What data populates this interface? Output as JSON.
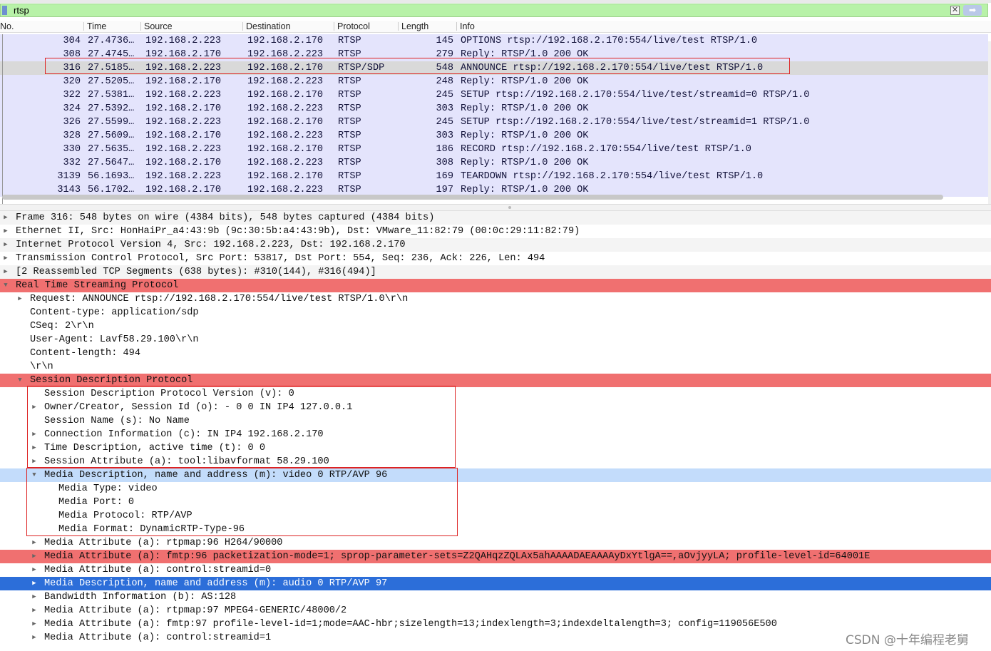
{
  "filter": {
    "value": "rtsp",
    "clear_icon": "clear-icon",
    "apply_icon": "apply-arrow-icon"
  },
  "columns": [
    "No.",
    "Time",
    "Source",
    "Destination",
    "Protocol",
    "Length",
    "Info"
  ],
  "packets": [
    {
      "no": "304",
      "time": "27.4736…",
      "src": "192.168.2.223",
      "dst": "192.168.2.170",
      "proto": "RTSP",
      "len": "145",
      "info": "OPTIONS rtsp://192.168.2.170:554/live/test RTSP/1.0"
    },
    {
      "no": "308",
      "time": "27.4745…",
      "src": "192.168.2.170",
      "dst": "192.168.2.223",
      "proto": "RTSP",
      "len": "279",
      "info": "Reply: RTSP/1.0 200 OK"
    },
    {
      "no": "316",
      "time": "27.5185…",
      "src": "192.168.2.223",
      "dst": "192.168.2.170",
      "proto": "RTSP/SDP",
      "len": "548",
      "info": "ANNOUNCE rtsp://192.168.2.170:554/live/test RTSP/1.0"
    },
    {
      "no": "320",
      "time": "27.5205…",
      "src": "192.168.2.170",
      "dst": "192.168.2.223",
      "proto": "RTSP",
      "len": "248",
      "info": "Reply: RTSP/1.0 200 OK"
    },
    {
      "no": "322",
      "time": "27.5381…",
      "src": "192.168.2.223",
      "dst": "192.168.2.170",
      "proto": "RTSP",
      "len": "245",
      "info": "SETUP rtsp://192.168.2.170:554/live/test/streamid=0 RTSP/1.0"
    },
    {
      "no": "324",
      "time": "27.5392…",
      "src": "192.168.2.170",
      "dst": "192.168.2.223",
      "proto": "RTSP",
      "len": "303",
      "info": "Reply: RTSP/1.0 200 OK"
    },
    {
      "no": "326",
      "time": "27.5599…",
      "src": "192.168.2.223",
      "dst": "192.168.2.170",
      "proto": "RTSP",
      "len": "245",
      "info": "SETUP rtsp://192.168.2.170:554/live/test/streamid=1 RTSP/1.0"
    },
    {
      "no": "328",
      "time": "27.5609…",
      "src": "192.168.2.170",
      "dst": "192.168.2.223",
      "proto": "RTSP",
      "len": "303",
      "info": "Reply: RTSP/1.0 200 OK"
    },
    {
      "no": "330",
      "time": "27.5635…",
      "src": "192.168.2.223",
      "dst": "192.168.2.170",
      "proto": "RTSP",
      "len": "186",
      "info": "RECORD rtsp://192.168.2.170:554/live/test RTSP/1.0"
    },
    {
      "no": "332",
      "time": "27.5647…",
      "src": "192.168.2.170",
      "dst": "192.168.2.223",
      "proto": "RTSP",
      "len": "308",
      "info": "Reply: RTSP/1.0 200 OK"
    },
    {
      "no": "3139",
      "time": "56.1693…",
      "src": "192.168.2.223",
      "dst": "192.168.2.170",
      "proto": "RTSP",
      "len": "169",
      "info": "TEARDOWN rtsp://192.168.2.170:554/live/test RTSP/1.0"
    },
    {
      "no": "3143",
      "time": "56.1702…",
      "src": "192.168.2.170",
      "dst": "192.168.2.223",
      "proto": "RTSP",
      "len": "197",
      "info": "Reply: RTSP/1.0 200 OK"
    }
  ],
  "details": [
    {
      "text": "Frame 316: 548 bytes on wire (4384 bits), 548 bytes captured (4384 bits)",
      "arrow": "right"
    },
    {
      "text": "Ethernet II, Src: HonHaiPr_a4:43:9b (9c:30:5b:a4:43:9b), Dst: VMware_11:82:79 (00:0c:29:11:82:79)",
      "arrow": "right"
    },
    {
      "text": "Internet Protocol Version 4, Src: 192.168.2.223, Dst: 192.168.2.170",
      "arrow": "right"
    },
    {
      "text": "Transmission Control Protocol, Src Port: 53817, Dst Port: 554, Seq: 236, Ack: 226, Len: 494",
      "arrow": "right"
    },
    {
      "text": "[2 Reassembled TCP Segments (638 bytes): #310(144), #316(494)]",
      "arrow": "right"
    },
    {
      "text": "Real Time Streaming Protocol",
      "arrow": "down"
    },
    {
      "text": "Request: ANNOUNCE rtsp://192.168.2.170:554/live/test RTSP/1.0\\r\\n",
      "arrow": "right"
    },
    {
      "text": "Content-type: application/sdp",
      "arrow": ""
    },
    {
      "text": "CSeq: 2\\r\\n",
      "arrow": ""
    },
    {
      "text": "User-Agent: Lavf58.29.100\\r\\n",
      "arrow": ""
    },
    {
      "text": "Content-length: 494",
      "arrow": ""
    },
    {
      "text": "\\r\\n",
      "arrow": ""
    },
    {
      "text": "Session Description Protocol",
      "arrow": "down"
    },
    {
      "text": "Session Description Protocol Version (v): 0",
      "arrow": ""
    },
    {
      "text": "Owner/Creator, Session Id (o): - 0 0 IN IP4 127.0.0.1",
      "arrow": "right"
    },
    {
      "text": "Session Name (s): No Name",
      "arrow": ""
    },
    {
      "text": "Connection Information (c): IN IP4 192.168.2.170",
      "arrow": "right"
    },
    {
      "text": "Time Description, active time (t): 0 0",
      "arrow": "right"
    },
    {
      "text": "Session Attribute (a): tool:libavformat 58.29.100",
      "arrow": "right"
    },
    {
      "text": "Media Description, name and address (m): video 0 RTP/AVP 96",
      "arrow": "down"
    },
    {
      "text": "Media Type: video",
      "arrow": ""
    },
    {
      "text": "Media Port: 0",
      "arrow": ""
    },
    {
      "text": "Media Protocol: RTP/AVP",
      "arrow": ""
    },
    {
      "text": "Media Format: DynamicRTP-Type-96",
      "arrow": ""
    },
    {
      "text": "Media Attribute (a): rtpmap:96 H264/90000",
      "arrow": "right"
    },
    {
      "text": "Media Attribute (a): fmtp:96 packetization-mode=1; sprop-parameter-sets=Z2QAHqzZQLAx5ahAAAADAEAAAAyDxYtlgA==,aOvjyyLA; profile-level-id=64001E",
      "arrow": "right"
    },
    {
      "text": "Media Attribute (a): control:streamid=0",
      "arrow": "right"
    },
    {
      "text": "Media Description, name and address (m): audio 0 RTP/AVP 97",
      "arrow": "right"
    },
    {
      "text": "Bandwidth Information (b): AS:128",
      "arrow": "right"
    },
    {
      "text": "Media Attribute (a): rtpmap:97 MPEG4-GENERIC/48000/2",
      "arrow": "right"
    },
    {
      "text": "Media Attribute (a): fmtp:97 profile-level-id=1;mode=AAC-hbr;sizelength=13;indexlength=3;indexdeltalength=3; config=119056E500",
      "arrow": "right"
    },
    {
      "text": "Media Attribute (a): control:streamid=1",
      "arrow": "right"
    }
  ],
  "watermark": "CSDN @十年编程老舅",
  "colors": {
    "row_bg": "#e4e4fc",
    "selected_row": "#d9d9d9",
    "error_highlight": "#f07070",
    "focus_blue": "#2c6ed9",
    "light_blue": "#c3dcfb",
    "annotation_red": "#dd2222"
  }
}
